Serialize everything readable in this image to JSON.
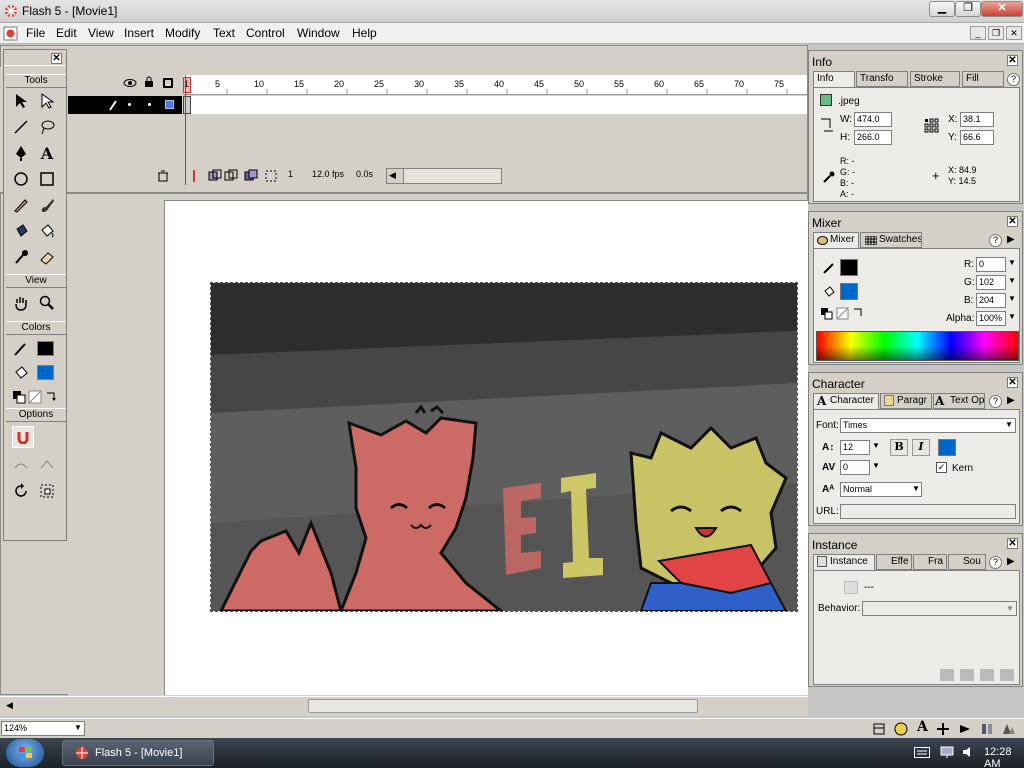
{
  "app": {
    "title": "Flash 5 - [Movie1]",
    "logo_icon": "flash-logo-icon"
  },
  "menu": [
    "File",
    "Edit",
    "View",
    "Insert",
    "Modify",
    "Text",
    "Control",
    "Window",
    "Help"
  ],
  "timeline": {
    "frame_numbers": [
      "1",
      "5",
      "10",
      "15",
      "20",
      "25",
      "30",
      "35",
      "40",
      "45",
      "50",
      "55",
      "60",
      "65",
      "70",
      "75"
    ],
    "current_frame": "1",
    "frame_rate": "12.0 fps",
    "elapsed": "0.0s"
  },
  "tools": {
    "title": "Tools",
    "view": "View",
    "colors": "Colors",
    "options": "Options",
    "stroke_color": "#000000",
    "fill_color": "#0066cc"
  },
  "info": {
    "title": "Info",
    "tabs": [
      "Info",
      "Transfo",
      "Stroke",
      "Fill"
    ],
    "name": ".jpeg",
    "w_label": "W:",
    "w": "474.0",
    "h_label": "H:",
    "h": "266.0",
    "x_label": "X:",
    "x": "38.1",
    "y_label": "Y:",
    "y": "66.6",
    "r": "R: -",
    "g": "G: -",
    "b": "B: -",
    "a": "A: -",
    "cursor_x": "X:  84.9",
    "cursor_y": "Y:  14.5"
  },
  "mixer": {
    "title": "Mixer",
    "tabs": [
      "Mixer",
      "Swatches"
    ],
    "r_label": "R:",
    "r": "0",
    "g_label": "G:",
    "g": "102",
    "b_label": "B:",
    "b": "204",
    "alpha_label": "Alpha:",
    "alpha": "100%"
  },
  "character": {
    "title": "Character",
    "tabs": [
      "Character",
      "Paragr",
      "Text Op"
    ],
    "font_label": "Font:",
    "font": "Times",
    "size": "12",
    "bold": "B",
    "italic": "I",
    "tracking": "0",
    "kern": "Kern",
    "baseline": "Normal",
    "url_label": "URL:"
  },
  "instance": {
    "title": "Instance",
    "tabs": [
      "Instance",
      "Effe",
      "Fra",
      "Sou"
    ],
    "symbol": "---",
    "behavior_label": "Behavior:"
  },
  "canvas": {
    "art_text": "E I"
  },
  "status": {
    "zoom": "124%"
  },
  "taskbar": {
    "task": "Flash 5 - [Movie1]",
    "clock": "12:28 AM"
  }
}
